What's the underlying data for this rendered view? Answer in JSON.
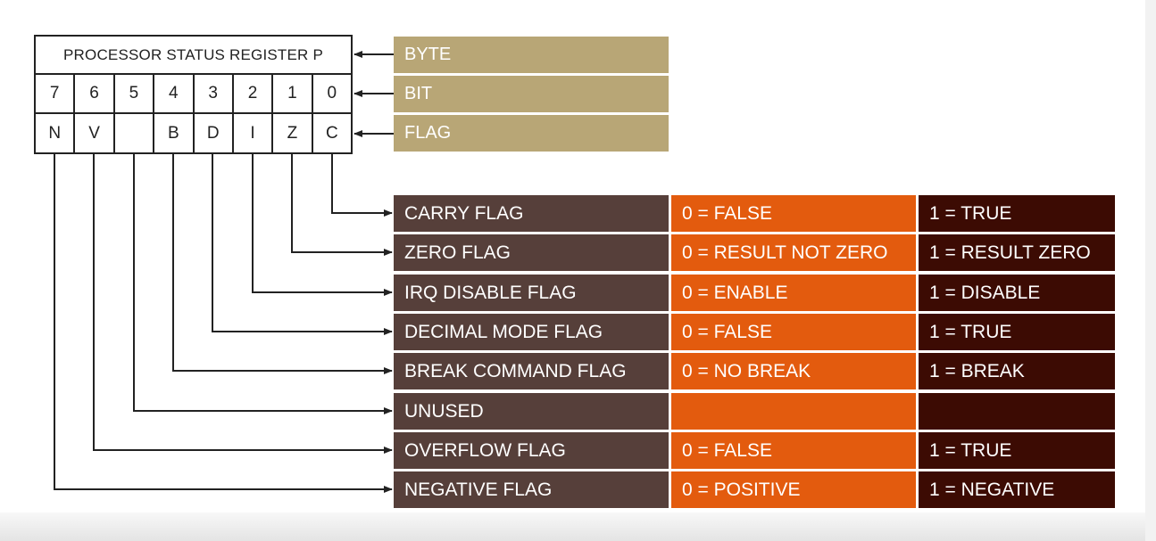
{
  "register": {
    "title": "PROCESSOR STATUS REGISTER P",
    "bits": [
      "7",
      "6",
      "5",
      "4",
      "3",
      "2",
      "1",
      "0"
    ],
    "flags": [
      "N",
      "V",
      "",
      "B",
      "D",
      "I",
      "Z",
      "C"
    ]
  },
  "legend": {
    "byte": "BYTE",
    "bit": "BIT",
    "flag": "FLAG"
  },
  "flag_table": [
    {
      "name": "CARRY FLAG",
      "zero": "0 = FALSE",
      "one": "1 = TRUE"
    },
    {
      "name": "ZERO FLAG",
      "zero": "0 = RESULT NOT ZERO",
      "one": "1 = RESULT ZERO"
    },
    {
      "name": "IRQ DISABLE FLAG",
      "zero": "0 = ENABLE",
      "one": "1 = DISABLE"
    },
    {
      "name": "DECIMAL MODE FLAG",
      "zero": "0 = FALSE",
      "one": "1 = TRUE"
    },
    {
      "name": "BREAK COMMAND FLAG",
      "zero": "0 = NO BREAK",
      "one": "1 = BREAK"
    },
    {
      "name": "UNUSED",
      "zero": "",
      "one": ""
    },
    {
      "name": "OVERFLOW FLAG",
      "zero": "0 = FALSE",
      "one": "1 = TRUE"
    },
    {
      "name": "NEGATIVE FLAG",
      "zero": "0 = POSITIVE",
      "one": "1 = NEGATIVE"
    }
  ],
  "colors": {
    "legend": "#b8a676",
    "name_cell": "#563f3a",
    "zero_cell": "#e35b0e",
    "one_cell": "#3c0b03",
    "line": "#222222"
  }
}
